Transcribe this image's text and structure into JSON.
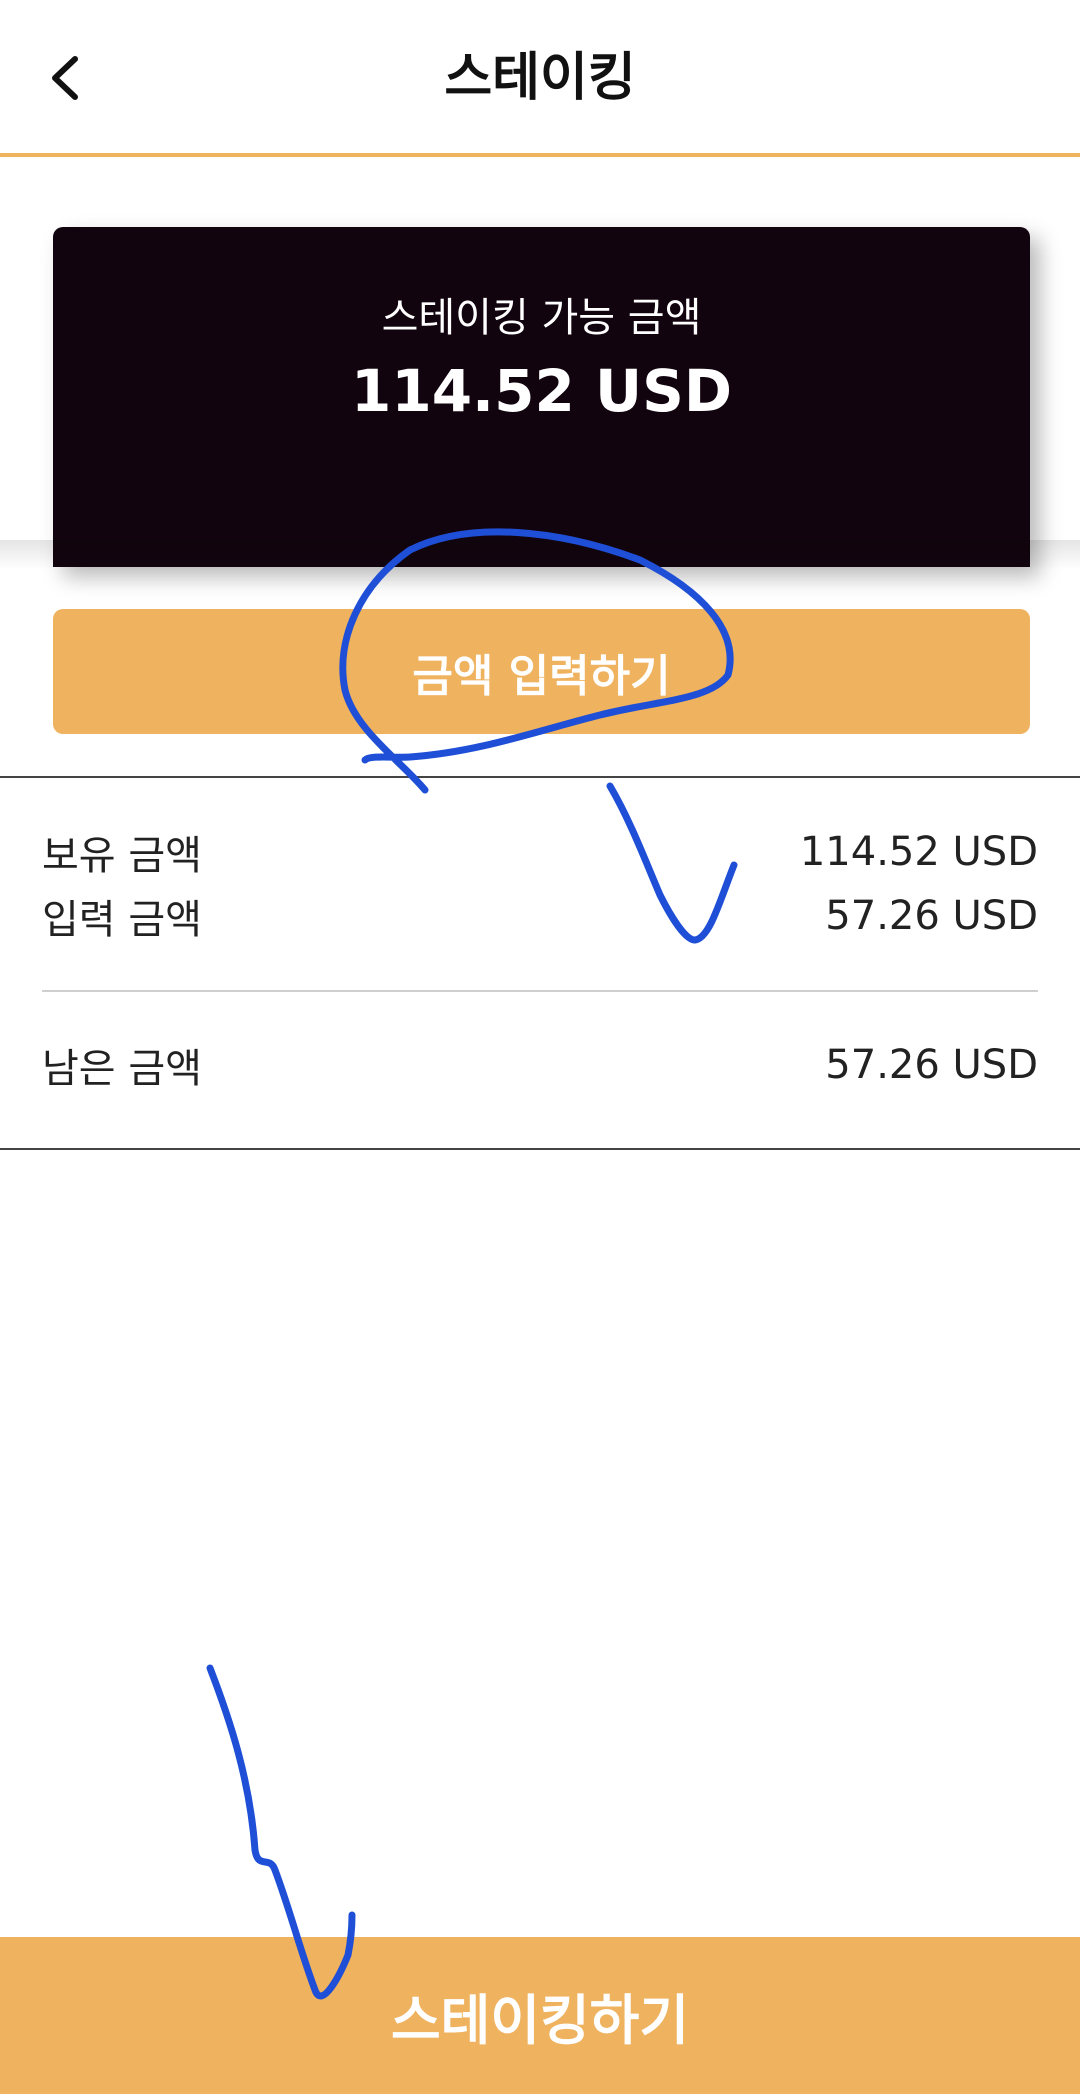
{
  "header": {
    "title": "스테이킹",
    "back_icon": "chevron-left-icon"
  },
  "balance_card": {
    "label": "스테이킹 가능 금액",
    "value": "114.52 USD"
  },
  "input_button": {
    "label": "금액 입력하기"
  },
  "summary": {
    "held": {
      "label": "보유 금액",
      "value": "114.52 USD"
    },
    "entered": {
      "label": "입력 금액",
      "value": "57.26 USD"
    },
    "remaining": {
      "label": "남은 금액",
      "value": "57.26 USD"
    }
  },
  "footer": {
    "stake_label": "스테이킹하기"
  },
  "colors": {
    "accent": "#efb25f",
    "card": "#12040e",
    "annotation": "#1f4fd6"
  }
}
